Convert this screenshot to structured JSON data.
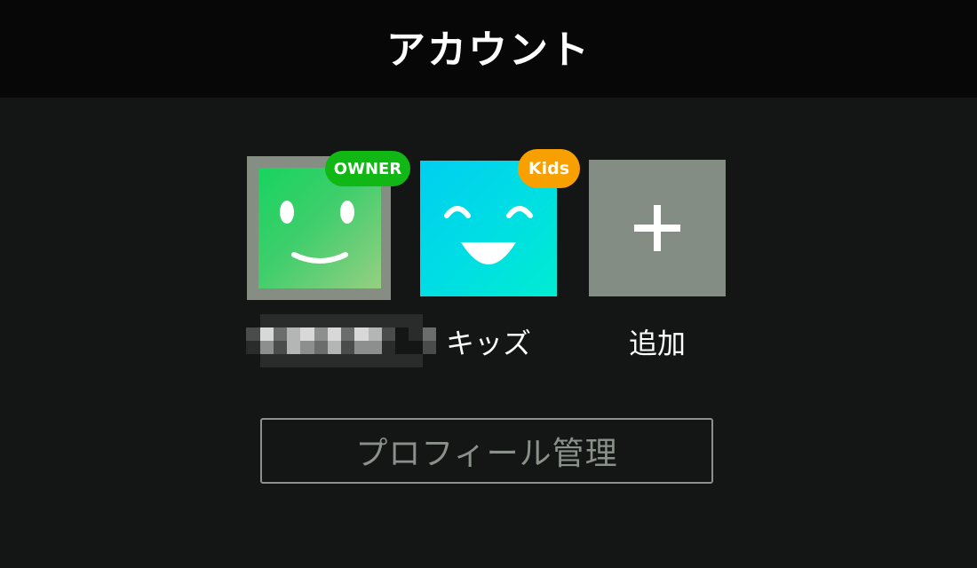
{
  "header": {
    "title": "アカウント"
  },
  "profiles": [
    {
      "name_display": "",
      "badge": "OWNER",
      "badge_color": "#11b815",
      "icon": "smile-face-icon"
    },
    {
      "name_display": "キッズ",
      "badge": "Kids",
      "badge_color": "#f7a000",
      "icon": "grin-face-icon"
    }
  ],
  "add_profile": {
    "label": "追加",
    "icon": "plus-icon"
  },
  "manage_button": {
    "label": "プロフィール管理"
  },
  "colors": {
    "header_bg": "#070707",
    "page_bg": "#141515",
    "owner_avatar_start": "#17d45e",
    "owner_avatar_end": "#96cf82",
    "kids_avatar_start": "#00cff0",
    "kids_avatar_end": "#00ecd2",
    "add_tile_bg": "#848d84",
    "button_border": "#8a918a"
  }
}
